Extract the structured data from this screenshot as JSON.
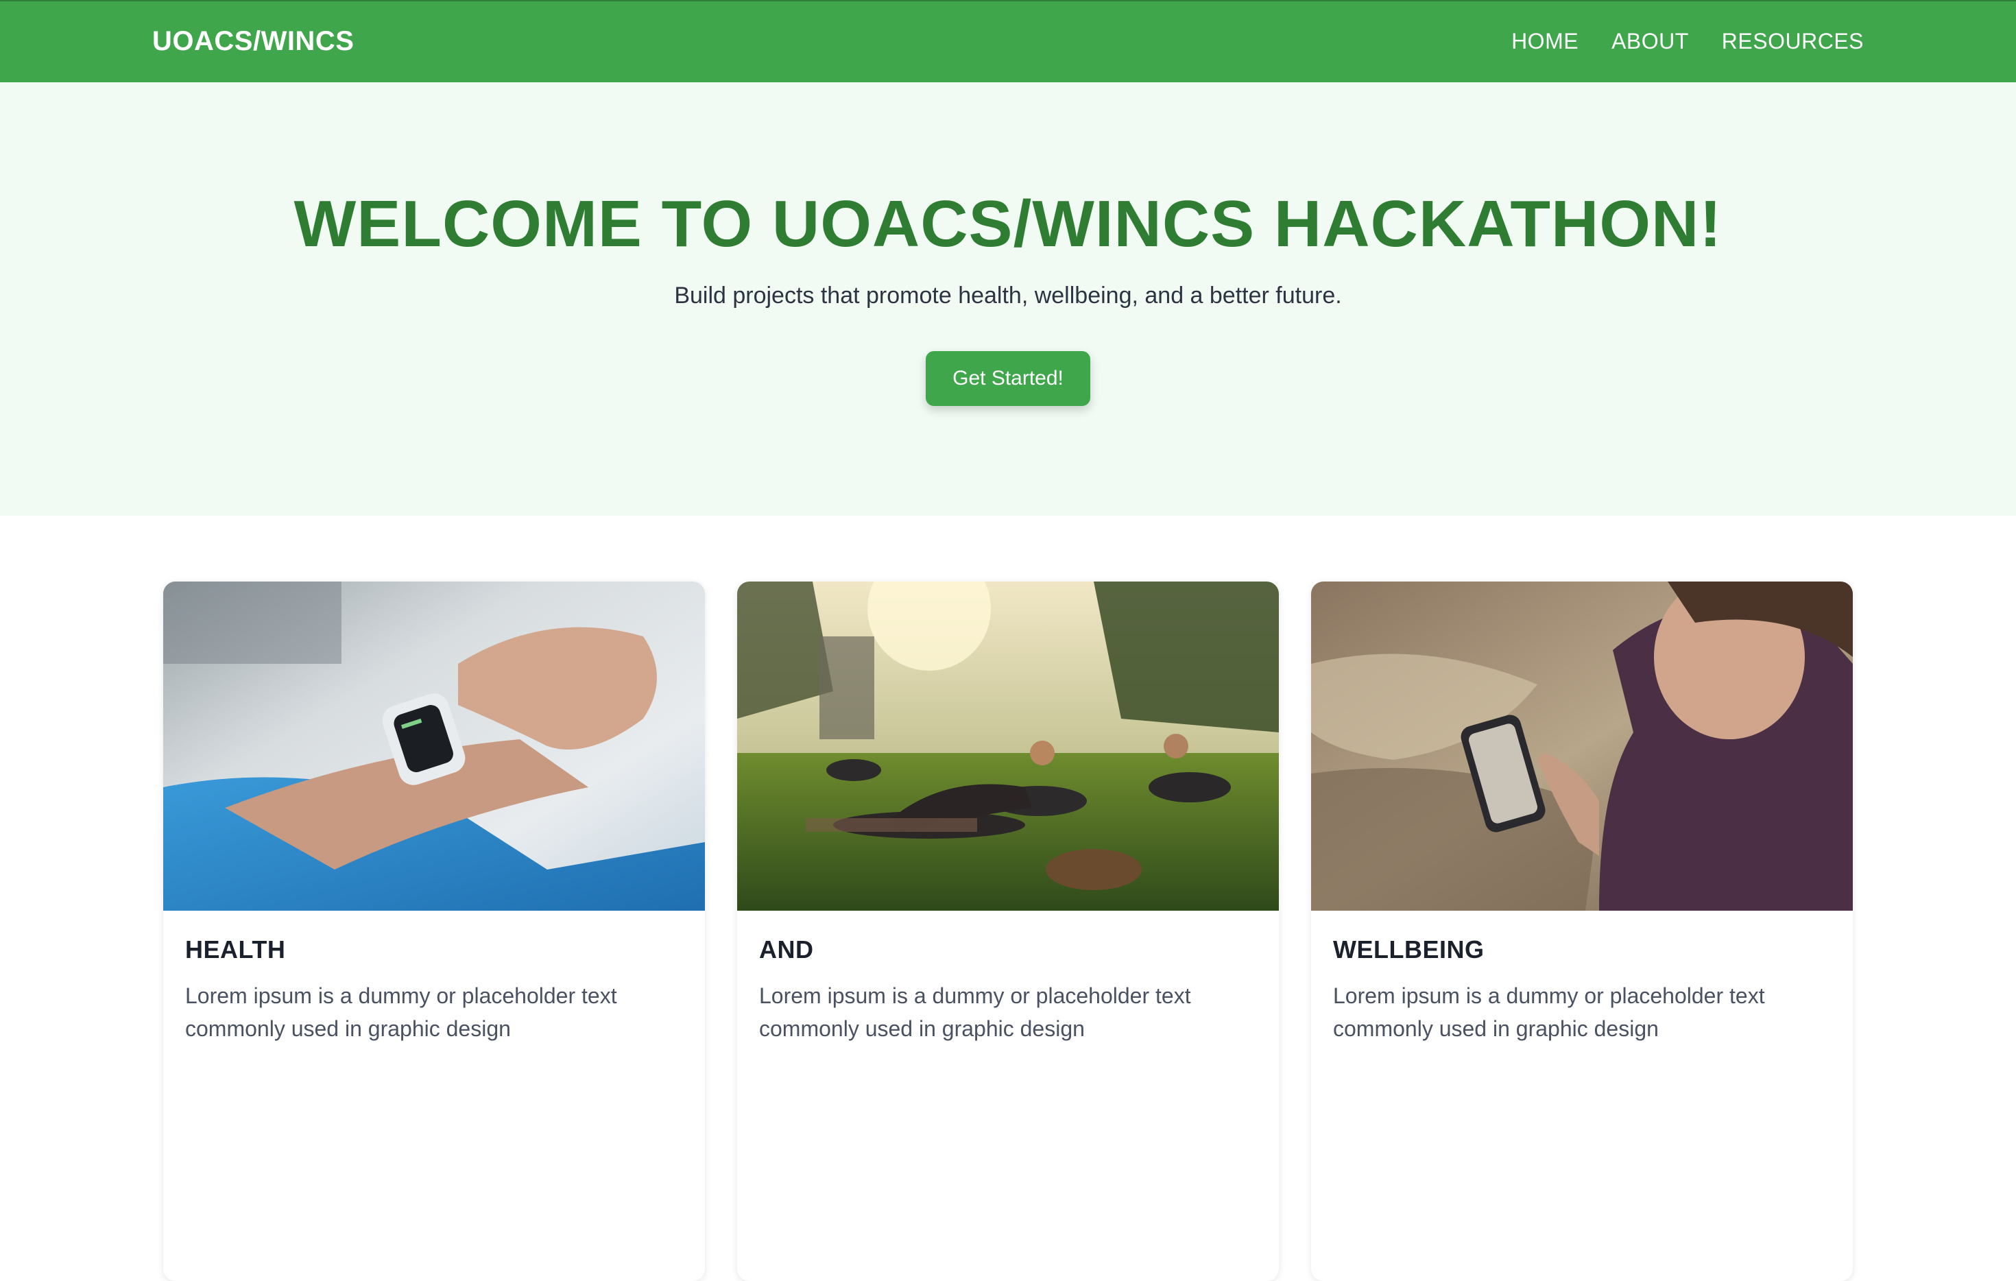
{
  "navbar": {
    "brand": "UOACS/WINCS",
    "links": [
      "HOME",
      "ABOUT",
      "RESOURCES"
    ]
  },
  "hero": {
    "title": "WELCOME TO UOACS/WINCS HACKATHON!",
    "subtitle": "Build projects that promote health, wellbeing, and a better future.",
    "cta_label": "Get Started!"
  },
  "cards": [
    {
      "title": "HEALTH",
      "text": "Lorem ipsum is a dummy or placeholder text commonly used in graphic design",
      "image": "smartwatch-photo"
    },
    {
      "title": "AND",
      "text": "Lorem ipsum is a dummy or placeholder text commonly used in graphic design",
      "image": "outdoor-yoga-photo"
    },
    {
      "title": "WELLBEING",
      "text": "Lorem ipsum is a dummy or placeholder text commonly used in graphic design",
      "image": "phone-in-field-photo"
    }
  ],
  "colors": {
    "brand_green": "#3fa64c",
    "title_green": "#2e7d32",
    "hero_bg": "#f1fbf3"
  }
}
